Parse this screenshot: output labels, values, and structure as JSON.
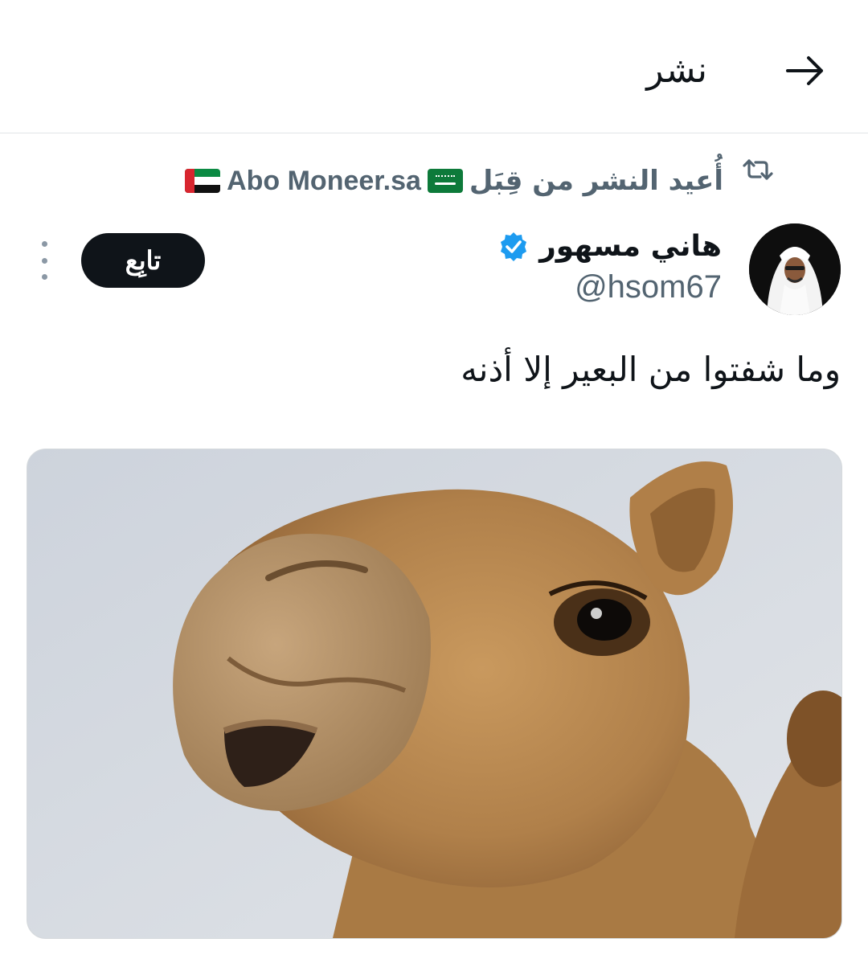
{
  "header": {
    "title": "نشر",
    "back_icon": "arrow-right-icon"
  },
  "repost": {
    "prefix": "أُعيد النشر من قِبَل",
    "user": "Abo Moneer.sa",
    "icon": "repost-icon",
    "flags": [
      "saudi-flag",
      "uae-flag"
    ]
  },
  "author": {
    "name": "هاني مسهور",
    "handle": "@hsom67",
    "verified": true,
    "verified_color": "#1d9bf0"
  },
  "follow": {
    "label": "تابِع"
  },
  "tweet": {
    "text": "وما شفتوا من البعير إلا أذنه"
  },
  "media": {
    "subject": "camel-photo"
  },
  "colors": {
    "text_primary": "#0f1419",
    "text_secondary": "#536471",
    "follow_bg": "#0f1419",
    "divider": "#e1e4e7"
  }
}
